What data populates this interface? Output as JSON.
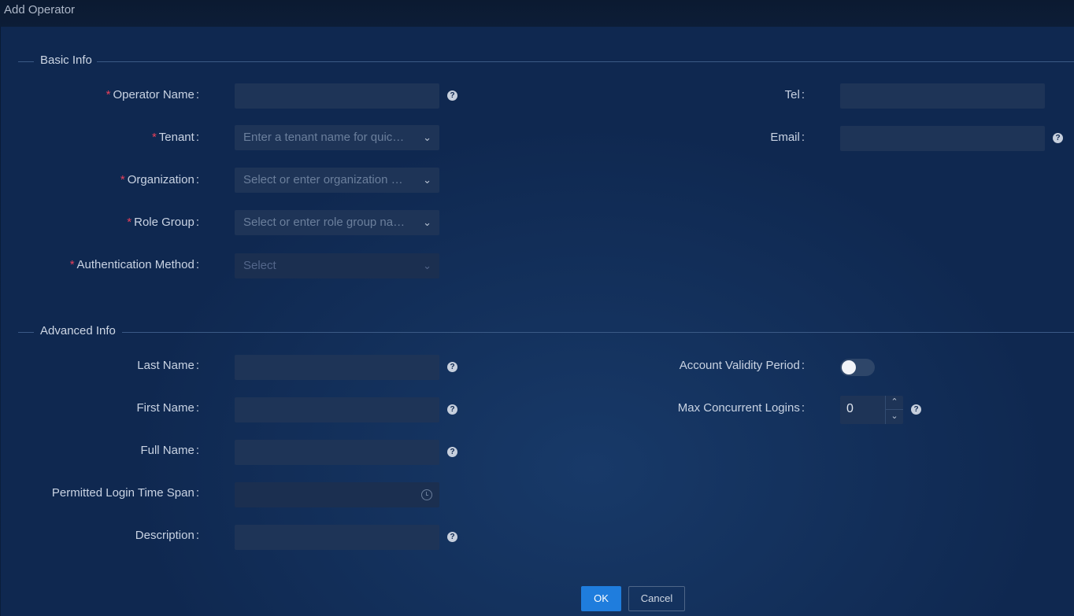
{
  "window": {
    "title": "Add Operator"
  },
  "basic_info": {
    "header": "Basic Info",
    "operator_name": {
      "label": "Operator Name",
      "value": "",
      "placeholder": ""
    },
    "tenant": {
      "label": "Tenant",
      "placeholder": "Enter a tenant name for quick search"
    },
    "organization": {
      "label": "Organization",
      "placeholder": "Select or enter organization name"
    },
    "role_group": {
      "label": "Role Group",
      "placeholder": "Select or enter role group name"
    },
    "auth_method": {
      "label": "Authentication Method",
      "placeholder": "Select"
    },
    "tel": {
      "label": "Tel",
      "value": ""
    },
    "email": {
      "label": "Email",
      "value": ""
    }
  },
  "advanced_info": {
    "header": "Advanced Info",
    "last_name": {
      "label": "Last Name",
      "value": ""
    },
    "first_name": {
      "label": "First Name",
      "value": ""
    },
    "full_name": {
      "label": "Full Name",
      "value": ""
    },
    "login_time_span": {
      "label": "Permitted Login Time Span",
      "value": ""
    },
    "description": {
      "label": "Description",
      "value": ""
    },
    "account_validity": {
      "label": "Account Validity Period",
      "enabled": false
    },
    "max_logins": {
      "label": "Max Concurrent Logins",
      "value": "0"
    }
  },
  "footer": {
    "ok_label": "OK",
    "cancel_label": "Cancel"
  },
  "colors": {
    "primary": "#1f7ddd",
    "required": "#e8405a",
    "field_bg": "#1e3457",
    "panel_bg": "#0f2850"
  },
  "icons": {
    "help": "help-icon",
    "dropdown": "chevron-down-icon",
    "time": "clock-icon"
  }
}
